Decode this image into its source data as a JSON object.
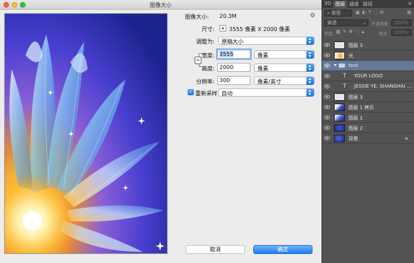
{
  "dialog": {
    "title": "图像大小",
    "image_size_label": "图像大小:",
    "image_size_value": "20.3M",
    "dimensions_label": "尺寸:",
    "dimensions_value": "3555 像素  X  2000 像素",
    "fit_label": "调整为:",
    "fit_value": "原稿大小",
    "width_label": "宽度:",
    "width_value": "3555",
    "width_unit": "像素",
    "height_label": "高度:",
    "height_value": "2000",
    "height_unit": "像素",
    "resolution_label": "分辨率:",
    "resolution_value": "300",
    "resolution_unit": "像素/英寸",
    "resample_label": "重新采样:",
    "resample_value": "自动",
    "cancel_label": "取消",
    "ok_label": "确定"
  },
  "panel": {
    "tabs": [
      "3D",
      "图层",
      "通道",
      "路径"
    ],
    "kind_filter": "类型",
    "blend_mode": "穿透",
    "opacity_label": "不透明度:",
    "opacity_value": "100%",
    "lock_label": "锁定:",
    "fill_label": "填充:",
    "fill_value": "100%",
    "layers": [
      {
        "name": "图层 3",
        "type": "pixel",
        "thumb": "checker"
      },
      {
        "name": "光",
        "type": "pixel",
        "thumb": "glow"
      },
      {
        "name": "text",
        "type": "group",
        "thumb": "folder"
      },
      {
        "name": "YOUR LOGO",
        "type": "text",
        "thumb": "T"
      },
      {
        "name": "JESSIE YE, SHANGHAI ...",
        "type": "text",
        "thumb": "T"
      },
      {
        "name": "图层 3",
        "type": "pixel",
        "thumb": "checker"
      },
      {
        "name": "图层 1 拷贝",
        "type": "pixel",
        "thumb": "image"
      },
      {
        "name": "图层 1",
        "type": "pixel",
        "thumb": "image"
      },
      {
        "name": "图层 2",
        "type": "pixel",
        "thumb": "blue"
      },
      {
        "name": "背景",
        "type": "background",
        "thumb": "blue"
      }
    ]
  },
  "colors": {
    "accent": "#1b7bf5",
    "selected_layer": "#657a99",
    "panel_bg": "#535353"
  }
}
